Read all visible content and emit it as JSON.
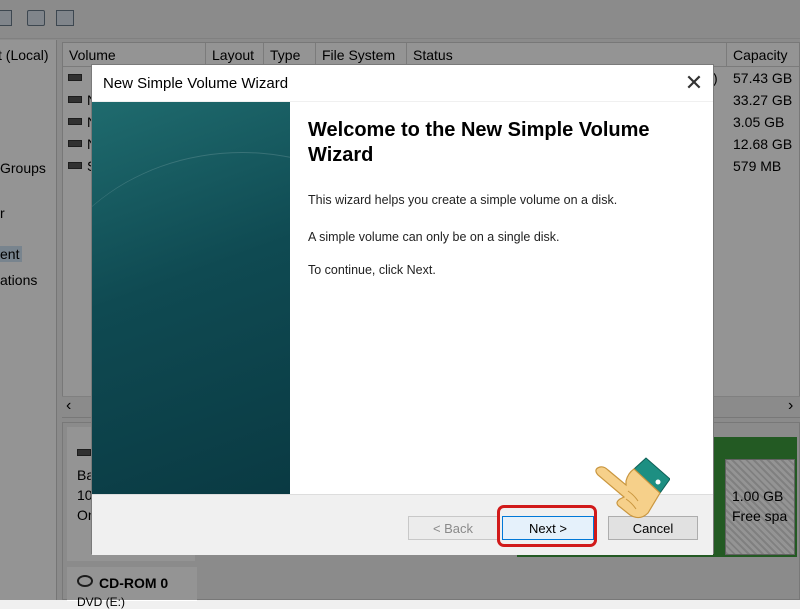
{
  "tree": {
    "items": [
      {
        "label": "t (Local)"
      },
      {
        "label": "Groups"
      },
      {
        "label": "r"
      },
      {
        "label": "ent"
      },
      {
        "label": "ations"
      }
    ]
  },
  "volume_list": {
    "columns": [
      "Volume",
      "Layout",
      "Type",
      "File System",
      "Status",
      "Capacity"
    ],
    "rows": [
      {
        "name": "",
        "capacity": "57.43 GB"
      },
      {
        "name": "N",
        "capacity": "33.27 GB"
      },
      {
        "name": "N",
        "capacity": "3.05 GB"
      },
      {
        "name": "N",
        "capacity": "12.68 GB"
      },
      {
        "name": "S",
        "capacity": "579 MB"
      }
    ],
    "status_fragment": ")"
  },
  "disk_area": {
    "disk0": {
      "line1": "Bas",
      "line2": "10",
      "line3": "On"
    },
    "cdrom": {
      "label": "CD-ROM 0",
      "sub": "DVD (E:)"
    },
    "free_partition": {
      "size": "1.00 GB",
      "label": "Free spa"
    }
  },
  "wizard": {
    "title": "New Simple Volume Wizard",
    "close_glyph": "✕",
    "heading": "Welcome to the New Simple Volume Wizard",
    "paragraphs": [
      "This wizard helps you create a simple volume on a disk.",
      "A simple volume can only be on a single disk.",
      "To continue, click Next."
    ],
    "buttons": {
      "back": "< Back",
      "next": "Next >",
      "cancel": "Cancel"
    }
  },
  "scroll": {
    "left_arrow": "‹",
    "right_arrow": "›"
  },
  "colors": {
    "highlight": "#d11a1a",
    "side_panel": "#0f4a52",
    "partition_green": "#3d9b3d",
    "hand": "#f6d08a",
    "cuff": "#1d8f82"
  },
  "icons": [
    "disk-list-icon",
    "properties-icon",
    "help-icon",
    "drive-icon",
    "cdrom-icon",
    "pointing-hand-icon",
    "close-icon"
  ]
}
